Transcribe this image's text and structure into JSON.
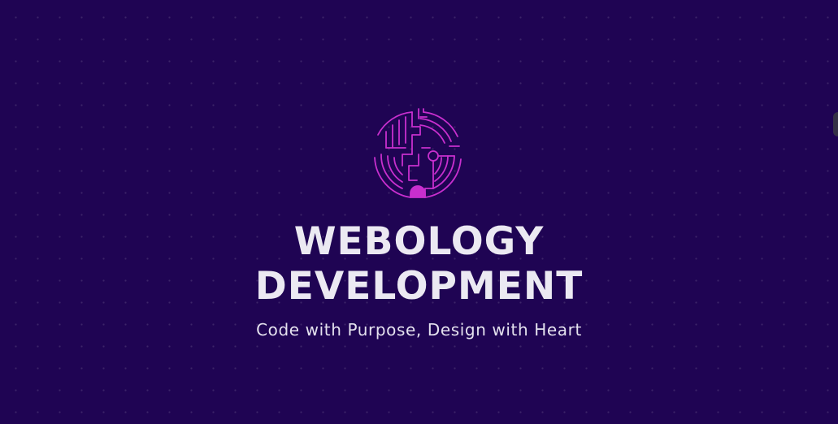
{
  "hero": {
    "logo_icon": "circuit-brain-logo-icon",
    "title_line1": "WEBOLOGY",
    "title_line2": "DEVELOPMENT",
    "tagline": "Code with Purpose, Design with Heart"
  },
  "colors": {
    "background": "#1f0453",
    "accent": "#c231c9",
    "text": "#ebe9f2"
  }
}
